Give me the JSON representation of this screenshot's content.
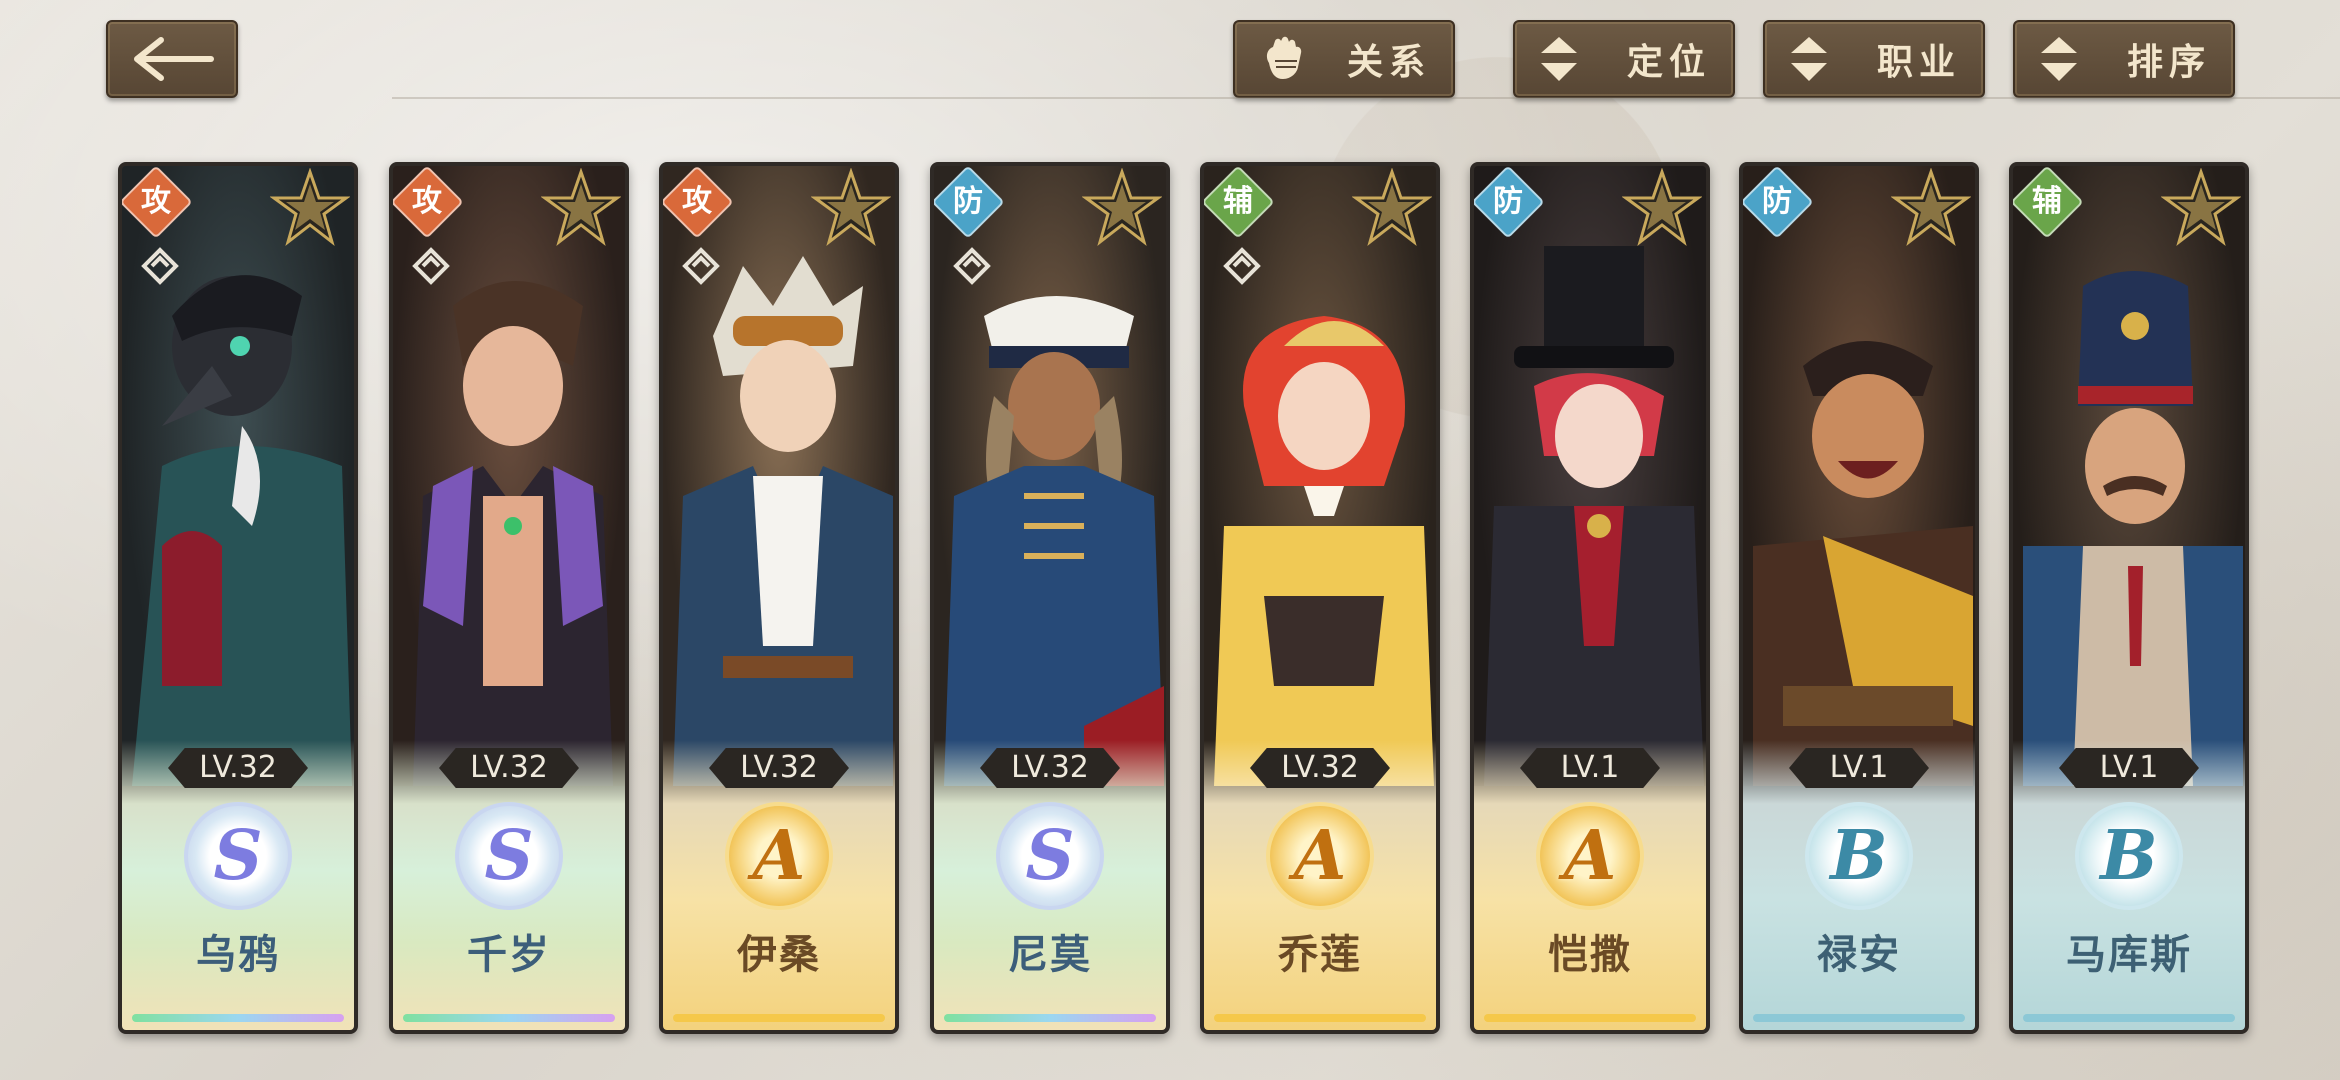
{
  "top_bar": {
    "back_label": "←",
    "buttons": [
      {
        "label": "关系",
        "icon": "glove-icon"
      },
      {
        "label": "定位",
        "icon": "sort-updown-icon"
      },
      {
        "label": "职业",
        "icon": "sort-updown-icon"
      },
      {
        "label": "排序",
        "icon": "sort-updown-icon"
      }
    ]
  },
  "colors": {
    "attack": "#d9693a",
    "defense": "#4ba3c8",
    "support": "#6aa54a"
  },
  "characters": [
    {
      "name": "乌鸦",
      "role": "攻",
      "level": "LV.32",
      "rank": "S"
    },
    {
      "name": "千岁",
      "role": "攻",
      "level": "LV.32",
      "rank": "S"
    },
    {
      "name": "伊桑",
      "role": "攻",
      "level": "LV.32",
      "rank": "A"
    },
    {
      "name": "尼莫",
      "role": "防",
      "level": "LV.32",
      "rank": "S"
    },
    {
      "name": "乔莲",
      "role": "辅",
      "level": "LV.32",
      "rank": "A"
    },
    {
      "name": "恺撒",
      "role": "防",
      "level": "LV.1",
      "rank": "A"
    },
    {
      "name": "禄安",
      "role": "防",
      "level": "LV.1",
      "rank": "B"
    },
    {
      "name": "马库斯",
      "role": "辅",
      "level": "LV.1",
      "rank": "B"
    }
  ]
}
